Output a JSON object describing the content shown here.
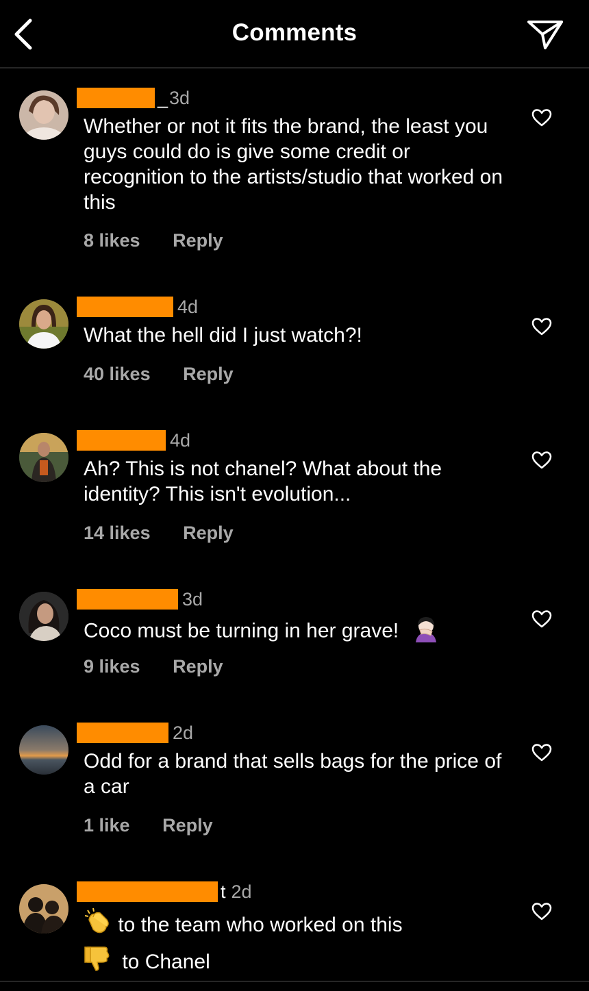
{
  "header": {
    "title": "Comments",
    "back_icon": "chevron-left-icon",
    "send_icon": "paper-plane-icon"
  },
  "colors": {
    "background": "#000000",
    "redaction": "#ff8c00",
    "muted_text": "#a8a8a8"
  },
  "comments": [
    {
      "username_suffix": "_",
      "time": "3d",
      "text": "Whether or not it fits the brand, the least you guys could do is give some credit or recognition to the artists/studio that worked on this",
      "likes": "8 likes",
      "reply": "Reply"
    },
    {
      "username_suffix": "",
      "time": "4d",
      "text": "What the hell did I just watch?!",
      "likes": "40 likes",
      "reply": "Reply"
    },
    {
      "username_suffix": "",
      "time": "4d",
      "text": "Ah? This is not chanel? What about the identity? This isn't evolution...",
      "likes": "14 likes",
      "reply": "Reply"
    },
    {
      "username_suffix": "",
      "time": "3d",
      "text": "Coco must be turning in her grave!",
      "emoji": "woman-facepalming-emoji",
      "likes": "9 likes",
      "reply": "Reply"
    },
    {
      "username_suffix": "",
      "time": "2d",
      "text": "Odd for a brand that sells bags for the price of a car",
      "likes": "1 like",
      "reply": "Reply"
    },
    {
      "username_suffix": "t",
      "time": "2d",
      "line1": "to the team who worked on this",
      "line1_emoji": "clapping-hands-emoji",
      "line2": "to Chanel",
      "line2_emoji": "thumbs-down-emoji"
    }
  ]
}
